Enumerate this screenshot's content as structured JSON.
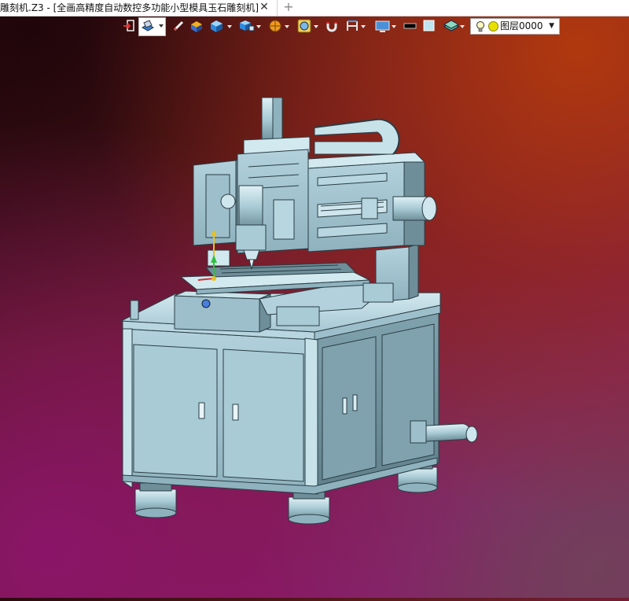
{
  "tab": {
    "title": "雕刻机.Z3 - [全画高精度自动数控多功能小型模具玉石雕刻机]",
    "close_glyph": "✕",
    "add_glyph": "+"
  },
  "toolbar": {
    "buttons": [
      {
        "name": "exit-view-icon"
      },
      {
        "name": "display-mode-icon",
        "active": true
      },
      {
        "name": "sketch-pencil-icon"
      },
      {
        "name": "shaded-box-icon"
      },
      {
        "name": "cube-view-icon"
      },
      {
        "name": "cube-multi-view-icon"
      },
      {
        "name": "render-sphere-icon"
      },
      {
        "name": "zoom-settings-icon"
      },
      {
        "name": "snap-magnet-icon"
      },
      {
        "name": "measure-icon"
      },
      {
        "name": "screen-capture-icon"
      },
      {
        "name": "line-color-swatch"
      },
      {
        "name": "fill-color-swatch"
      },
      {
        "name": "layer-stack-icon"
      }
    ],
    "layer": {
      "value": "图层0000",
      "arrow": "▼"
    }
  },
  "colors": {
    "machine": "#a9cbd6",
    "machine_dark": "#6e8f9a",
    "outline": "#2a3d44",
    "axis_x": "#d03030",
    "axis_y": "#30c040",
    "axis_z": "#e8c020"
  },
  "viewport": {
    "model": "cnc-engraving-machine"
  }
}
